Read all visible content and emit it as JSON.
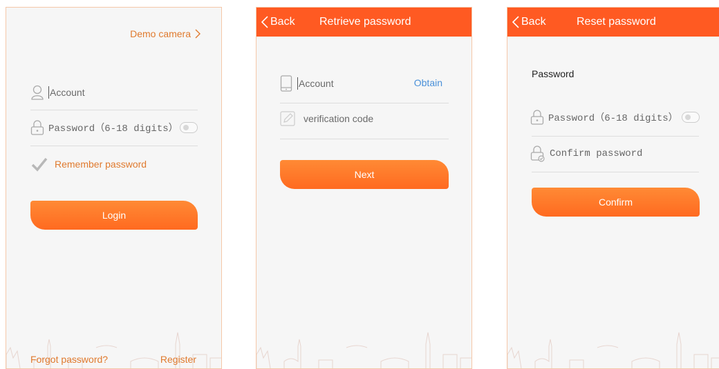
{
  "login": {
    "demo_camera": "Demo camera",
    "account_placeholder": "Account",
    "password_placeholder": "Password（6-18 digits）",
    "remember_label": "Remember password",
    "login_button": "Login",
    "forgot_link": "Forgot password?",
    "register_link": "Register"
  },
  "retrieve": {
    "back_label": "Back",
    "title": "Retrieve password",
    "account_placeholder": "Account",
    "obtain_label": "Obtain",
    "code_placeholder": "verification code",
    "next_button": "Next"
  },
  "reset": {
    "back_label": "Back",
    "title": "Reset password",
    "section_label": "Password",
    "password_placeholder": "Password（6-18 digits）",
    "confirm_placeholder": "Confirm password",
    "confirm_button": "Confirm"
  },
  "colors": {
    "accent": "#ff5a22",
    "button": "#ff7a2a",
    "link_blue": "#4a90d9",
    "link_orange": "#e07a2e"
  }
}
